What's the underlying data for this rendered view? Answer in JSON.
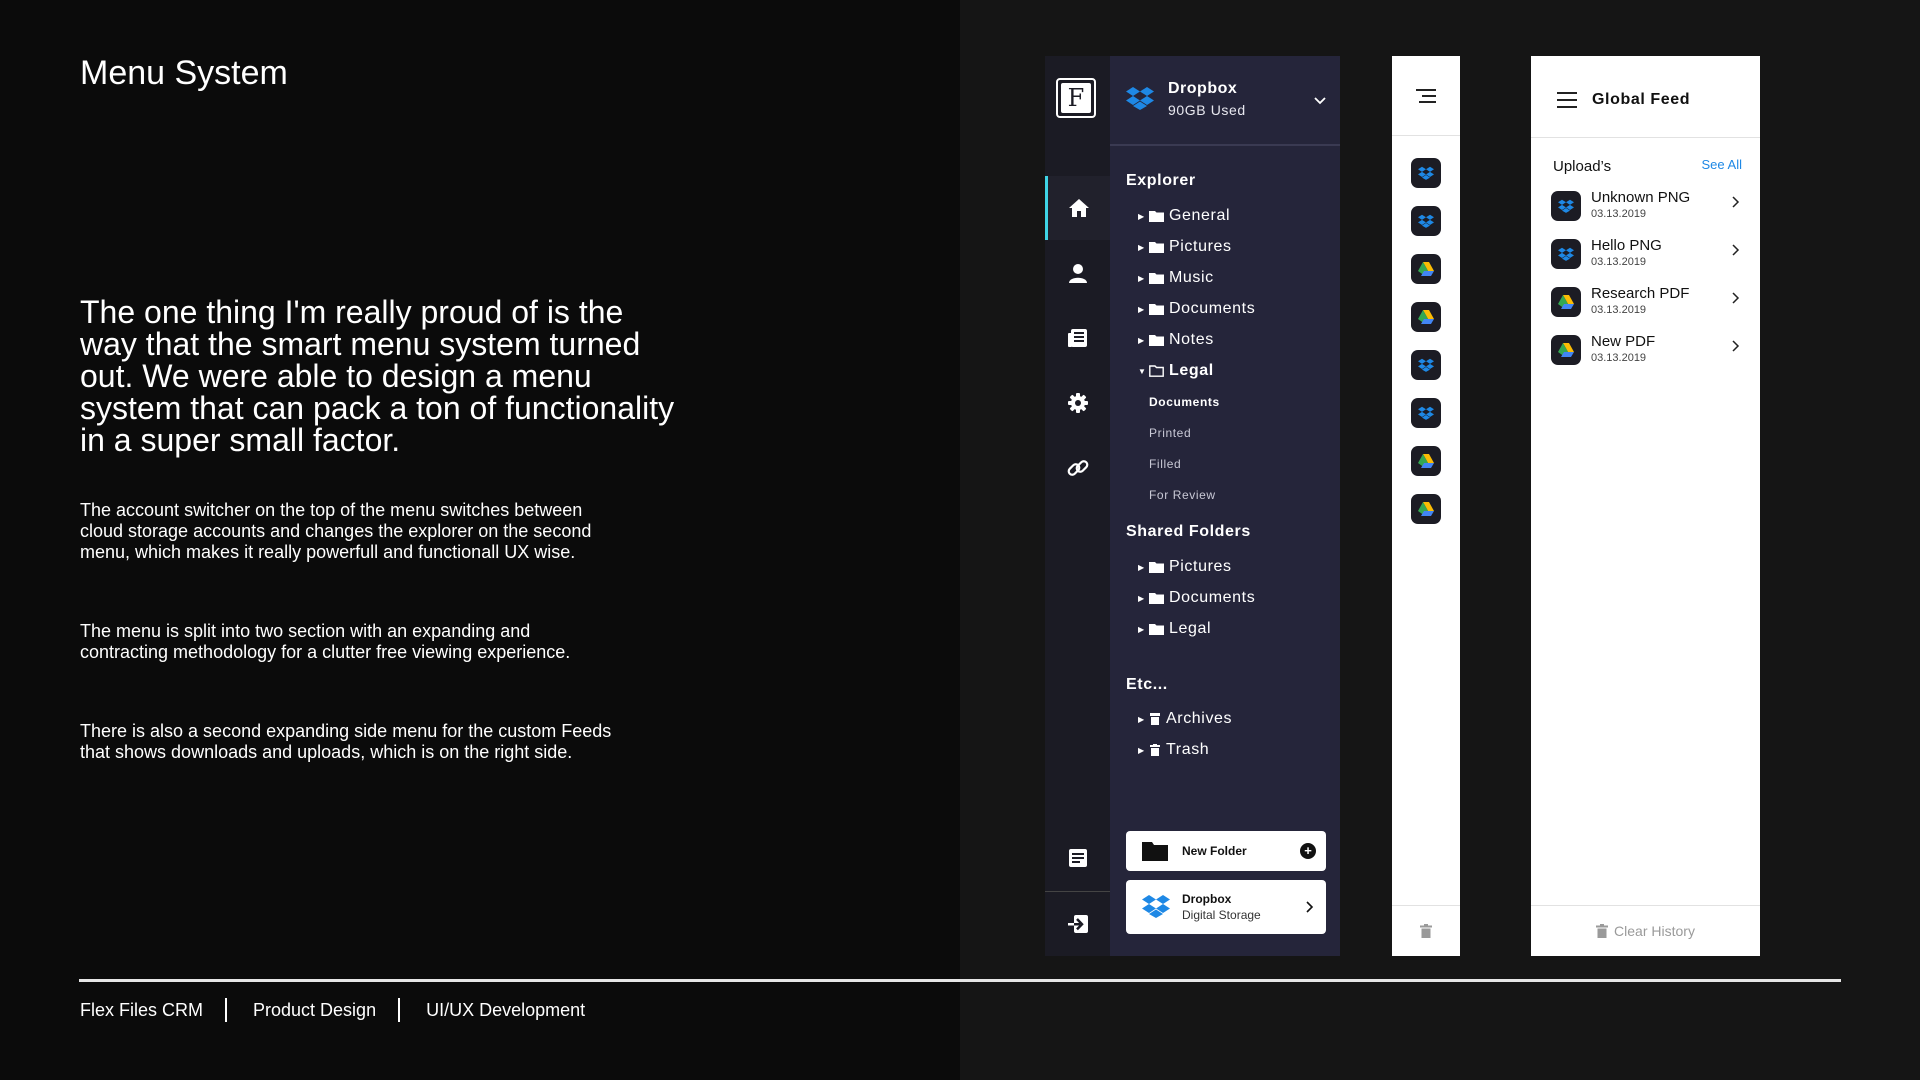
{
  "page": {
    "title": "Menu System",
    "lead": "The one thing I'm really proud of is the way that the smart menu system turned out. We were able to design a menu system that can pack a ton of functionality in a super small factor.",
    "paragraphs": [
      "The account switcher on the top of the menu switches between cloud storage accounts and changes the explorer on the second menu, which makes it really powerfull and functionall UX wise.",
      "The menu is split into two section with an expanding and contracting methodology for a clutter free viewing experience.",
      "There is also a second expanding side menu for the custom Feeds that shows downloads and uploads, which is on the right side."
    ],
    "footer": [
      "Flex Files CRM",
      "Product Design",
      "UI/UX Development"
    ]
  },
  "rail": {
    "logo_letter": "F",
    "icons": [
      "home-icon",
      "user-icon",
      "newspaper-icon",
      "gear-icon",
      "link-icon"
    ],
    "bottom_icons": [
      "notes-icon",
      "logout-icon"
    ],
    "accent": "#3fd5e6"
  },
  "explorer": {
    "account": {
      "name": "Dropbox",
      "usage": "90GB Used"
    },
    "sections": {
      "explorer": "Explorer",
      "shared": "Shared Folders",
      "etc": "Etc..."
    },
    "explorer_items": [
      "General",
      "Pictures",
      "Music",
      "Documents",
      "Notes",
      "Legal"
    ],
    "legal_sub": [
      "Documents",
      "Printed",
      "Filled",
      "For Review"
    ],
    "shared_items": [
      "Pictures",
      "Documents",
      "Legal"
    ],
    "etc_items": [
      "Archives",
      "Trash"
    ],
    "new_folder": "New Folder",
    "storage": {
      "name": "Dropbox",
      "desc": "Digital Storage"
    },
    "bg": "#25253a"
  },
  "mini": {
    "apps": [
      "dropbox",
      "dropbox",
      "drive",
      "drive",
      "dropbox",
      "dropbox",
      "drive",
      "drive"
    ]
  },
  "feed": {
    "title": "Global Feed",
    "uploads_label": "Upload’s",
    "see_all": "See All",
    "items": [
      {
        "name": "Unknown PNG",
        "date": "03.13.2019",
        "app": "dropbox"
      },
      {
        "name": "Hello PNG",
        "date": "03.13.2019",
        "app": "dropbox"
      },
      {
        "name": "Research PDF",
        "date": "03.13.2019",
        "app": "drive"
      },
      {
        "name": "New PDF",
        "date": "03.13.2019",
        "app": "drive"
      }
    ],
    "clear": "Clear History",
    "link_color": "#1e88e5"
  }
}
